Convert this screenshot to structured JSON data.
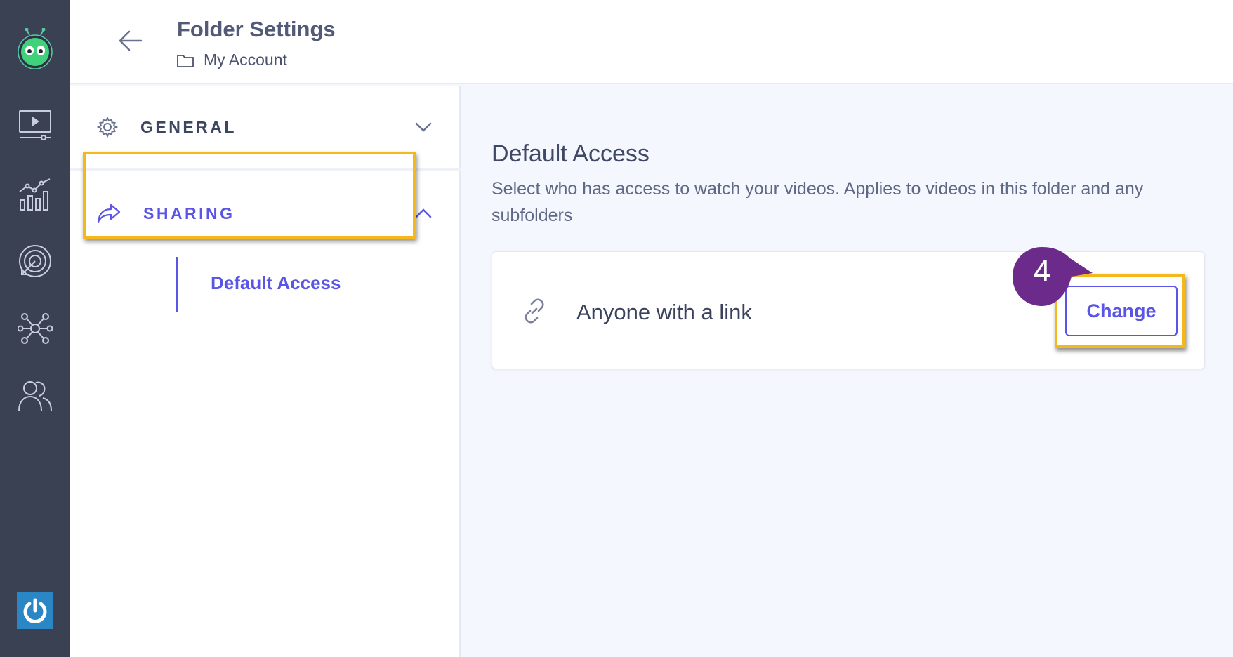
{
  "header": {
    "title": "Folder Settings",
    "breadcrumb": "My Account"
  },
  "nav": {
    "general_label": "GENERAL",
    "sharing_label": "SHARING",
    "default_access_label": "Default Access"
  },
  "main": {
    "heading": "Default Access",
    "description": "Select who has access to watch your videos. Applies to videos in this folder and any subfolders",
    "access_value": "Anyone with a link",
    "change_label": "Change"
  },
  "annotation": {
    "step_number": "4"
  },
  "colors": {
    "accent": "#5a55e6",
    "rail": "#3a4153",
    "highlight": "#f4b81c",
    "step_badge": "#6c2a8a"
  }
}
